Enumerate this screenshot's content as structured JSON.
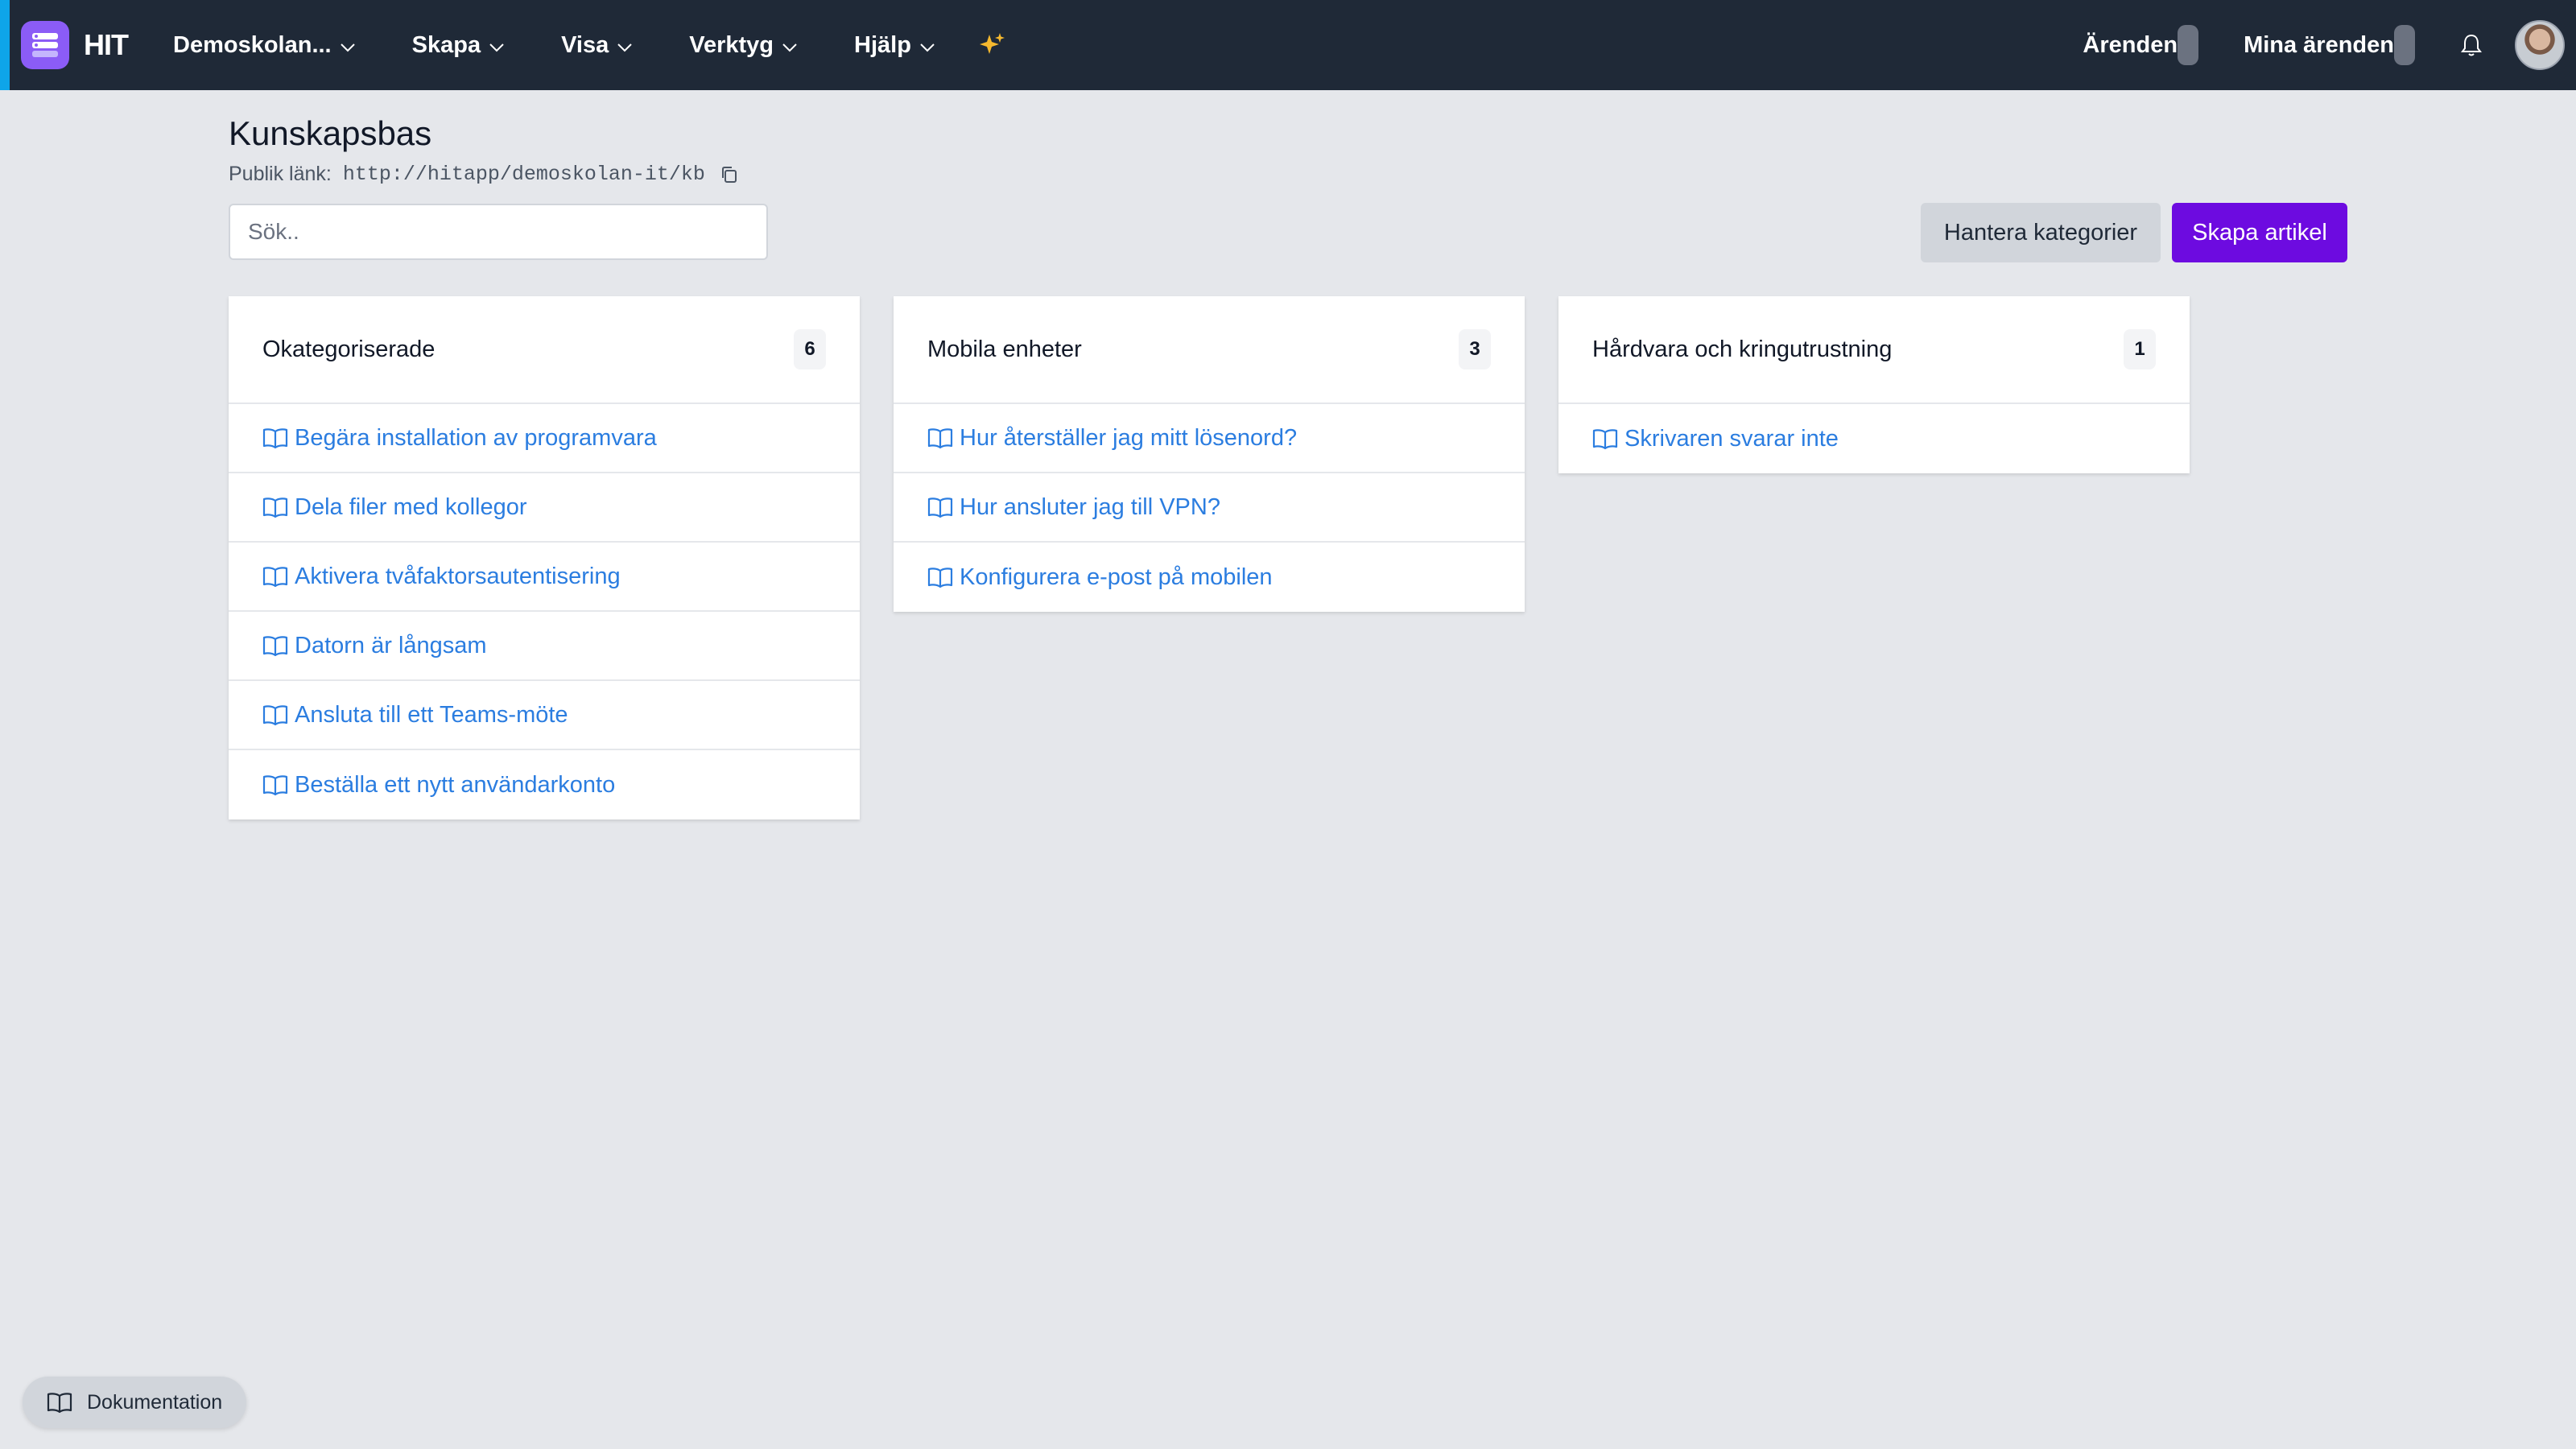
{
  "app": {
    "name": "HIT"
  },
  "nav": {
    "menu": [
      {
        "label": "Demoskolan..."
      },
      {
        "label": "Skapa"
      },
      {
        "label": "Visa"
      },
      {
        "label": "Verktyg"
      },
      {
        "label": "Hjälp"
      }
    ],
    "right": {
      "tickets_label": "Ärenden",
      "my_tickets_label": "Mina ärenden"
    }
  },
  "page": {
    "title": "Kunskapsbas",
    "public_link_label": "Publik länk:",
    "public_link_url": "http://hitapp/demoskolan-it/kb"
  },
  "search": {
    "placeholder": "Sök..",
    "value": ""
  },
  "actions": {
    "manage_categories": "Hantera kategorier",
    "create_article": "Skapa artikel"
  },
  "categories": [
    {
      "name": "Okategoriserade",
      "count": "6",
      "articles": [
        "Begära installation av programvara",
        "Dela filer med kollegor",
        "Aktivera tvåfaktorsautentisering",
        "Datorn är långsam",
        "Ansluta till ett Teams-möte",
        "Beställa ett nytt användarkonto"
      ]
    },
    {
      "name": "Mobila enheter",
      "count": "3",
      "articles": [
        "Hur återställer jag mitt lösenord?",
        "Hur ansluter jag till VPN?",
        "Konfigurera e-post på mobilen"
      ]
    },
    {
      "name": "Hårdvara och kringutrustning",
      "count": "1",
      "articles": [
        "Skrivaren svarar inte"
      ]
    }
  ],
  "footer": {
    "docs_label": "Dokumentation"
  },
  "colors": {
    "nav_bg": "#1f2937",
    "accent_strip": "#0ea5e9",
    "logo_bg": "#8b5cf6",
    "primary_button": "#6d0be0",
    "link": "#2b7de0",
    "sparkle": "#f5b82e",
    "page_bg": "#e5e7eb"
  },
  "icons": [
    "app-logo-icon",
    "chevron-down-icon",
    "sparkle-icon",
    "bell-icon",
    "copy-icon",
    "book-icon"
  ]
}
